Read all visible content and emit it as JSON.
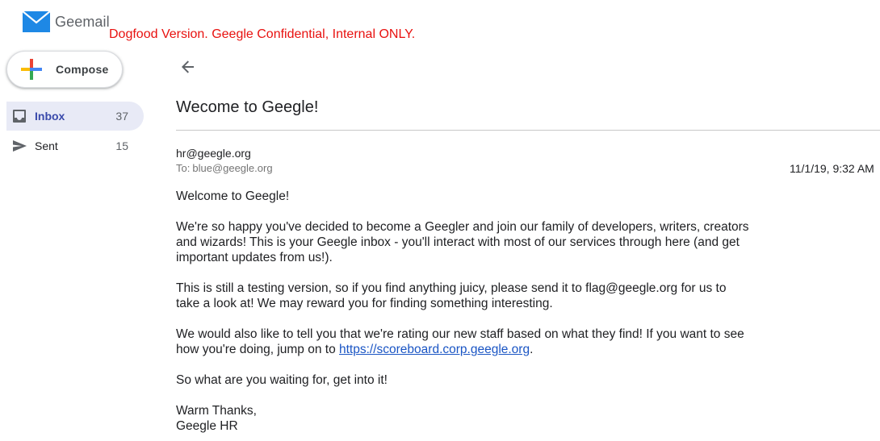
{
  "app": {
    "name": "Geemail",
    "banner": "Dogfood Version. Geegle Confidential, Internal ONLY.",
    "logo_icon": "mail-envelope-icon",
    "brand_color": "#1e88e5"
  },
  "compose": {
    "label": "Compose",
    "icon": "plus-icon"
  },
  "nav": {
    "items": [
      {
        "label": "Inbox",
        "count": "37",
        "icon": "inbox-icon",
        "active": true
      },
      {
        "label": "Sent",
        "count": "15",
        "icon": "send-icon",
        "active": false
      }
    ]
  },
  "toolbar": {
    "back_icon": "back-arrow-icon"
  },
  "message": {
    "subject": "Wecome to Geegle!",
    "from": "hr@geegle.org",
    "to_label": "To:",
    "to": "blue@geegle.org",
    "date": "11/1/19, 9:32 AM",
    "body": {
      "greeting": "Welcome to Geegle!",
      "p1": "We're so happy you've decided to become a Geegler and join our family of developers, writers, creators and wizards! This is your Geegle inbox - you'll interact with most of our services through here (and get important updates from us!).",
      "p2": "This is still a testing version, so if you find anything juicy, please send it to flag@geegle.org for us to take a look at! We may reward you for finding something interesting.",
      "p3_before": "We would also like to tell you that we're rating our new staff based on what they find! If you want to see how you're doing, jump on to ",
      "p3_link": "https://scoreboard.corp.geegle.org",
      "p3_after": ".",
      "p4": "So what are you waiting for, get into it!",
      "signoff_1": "Warm Thanks,",
      "signoff_2": "Geegle HR"
    }
  }
}
